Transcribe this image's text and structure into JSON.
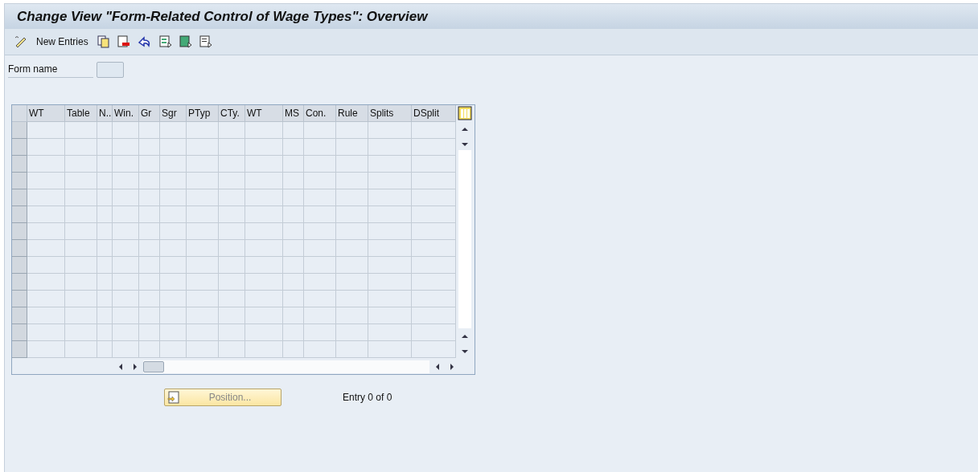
{
  "window": {
    "title": "Change View \"Form-Related Control of Wage Types\": Overview"
  },
  "toolbar": {
    "new_entries_label": "New Entries"
  },
  "form_name": {
    "label": "Form name"
  },
  "table": {
    "columns": [
      "WT",
      "Table",
      "N..",
      "Win.",
      "Gr",
      "Sgr",
      "PTyp",
      "CTy.",
      "WT",
      "MS",
      "Con.",
      "Rule",
      "Splits",
      "DSplit"
    ]
  },
  "position_button": {
    "label": "Position..."
  },
  "entry_count": "Entry 0 of 0"
}
